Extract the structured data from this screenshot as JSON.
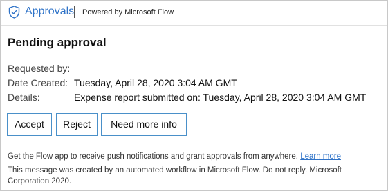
{
  "header": {
    "brand_icon": "approvals-shield-check-icon",
    "brand_name": "Approvals",
    "powered_by": "Powered by Microsoft Flow"
  },
  "title": "Pending approval",
  "fields": {
    "requested_by": {
      "label": "Requested by:",
      "value": ""
    },
    "date_created": {
      "label": "Date Created:",
      "value": "Tuesday, April 28, 2020 3:04 AM GMT"
    },
    "details": {
      "label": "Details:",
      "value": "Expense report submitted on: Tuesday, April 28, 2020 3:04 AM GMT"
    }
  },
  "actions": {
    "accept": "Accept",
    "reject": "Reject",
    "more_info": "Need more info"
  },
  "footer": {
    "app_prompt": "Get the Flow app to receive push notifications and grant approvals from anywhere.",
    "learn_more": "Learn more",
    "note": "This message was created by an automated workflow in Microsoft Flow. Do not reply. Microsoft Corporation 2020."
  },
  "colors": {
    "brand_blue": "#2f73c8",
    "button_border": "#4a90c9"
  }
}
